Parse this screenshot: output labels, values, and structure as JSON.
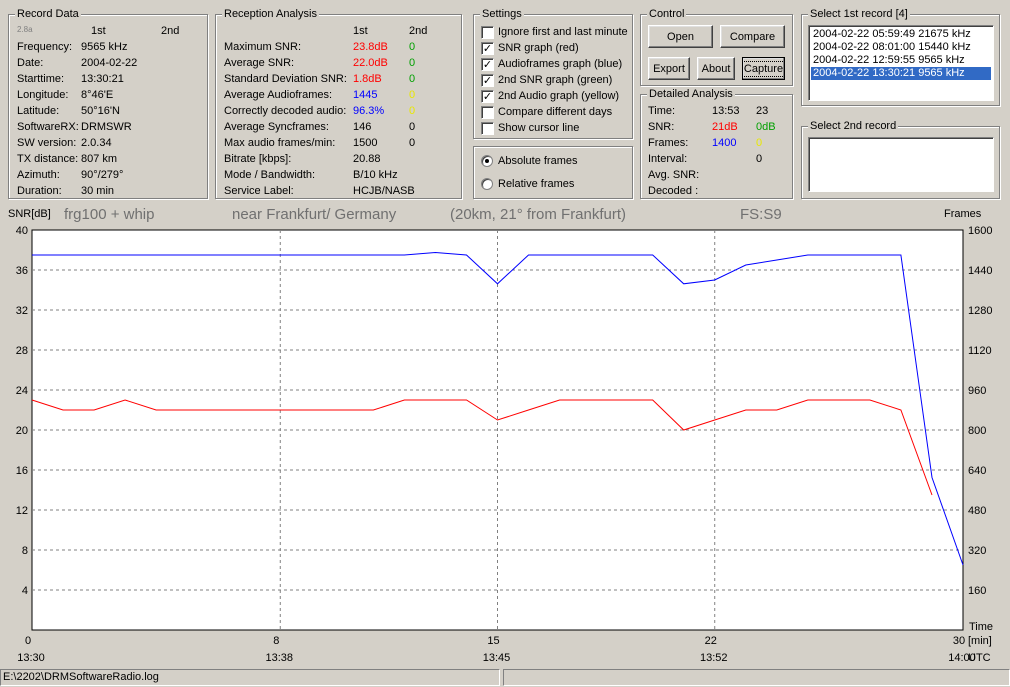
{
  "record_data": {
    "title": "Record Data",
    "ver": "2.8a",
    "col1": "1st",
    "col2": "2nd",
    "rows": [
      {
        "label": "Frequency:",
        "value": "9565 kHz"
      },
      {
        "label": "Date:",
        "value": "2004-02-22"
      },
      {
        "label": "Starttime:",
        "value": "13:30:21"
      },
      {
        "label": "Longitude:",
        "value": "8°46'E"
      },
      {
        "label": "Latitude:",
        "value": "50°16'N"
      },
      {
        "label": "SoftwareRX:",
        "value": "DRMSWR"
      },
      {
        "label": "SW version:",
        "value": "2.0.34"
      },
      {
        "label": "TX distance:",
        "value": "807 km"
      },
      {
        "label": "Azimuth:",
        "value": "90°/279°"
      },
      {
        "label": "Duration:",
        "value": "30 min"
      }
    ]
  },
  "reception": {
    "title": "Reception Analysis",
    "col1": "1st",
    "col2": "2nd",
    "rows": [
      {
        "label": "Maximum SNR:",
        "v1": "23.8dB",
        "v2": "0",
        "c1": "red",
        "c2": "green"
      },
      {
        "label": "Average SNR:",
        "v1": "22.0dB",
        "v2": "0",
        "c1": "red",
        "c2": "green"
      },
      {
        "label": "Standard Deviation SNR:",
        "v1": "1.8dB",
        "v2": "0",
        "c1": "red",
        "c2": "green"
      },
      {
        "label": "Average Audioframes:",
        "v1": "1445",
        "v2": "0",
        "c1": "blue",
        "c2": "yellow"
      },
      {
        "label": "Correctly decoded audio:",
        "v1": "96.3%",
        "v2": "0",
        "c1": "blue",
        "c2": "yellow"
      },
      {
        "label": "Average Syncframes:",
        "v1": "146",
        "v2": "0",
        "c1": "",
        "c2": ""
      },
      {
        "label": "Max audio frames/min:",
        "v1": "1500",
        "v2": "0",
        "c1": "",
        "c2": ""
      },
      {
        "label": "Bitrate [kbps]:",
        "v1": "20.88",
        "v2": "",
        "c1": "",
        "c2": ""
      },
      {
        "label": "Mode / Bandwidth:",
        "v1": "B/10 kHz",
        "v2": "",
        "c1": "",
        "c2": ""
      },
      {
        "label": "Service Label:",
        "v1": "HCJB/NASB",
        "v2": "",
        "c1": "",
        "c2": ""
      }
    ]
  },
  "settings": {
    "title": "Settings",
    "checkboxes": [
      {
        "label": "Ignore first and last minute",
        "checked": false
      },
      {
        "label": "SNR graph (red)",
        "checked": true
      },
      {
        "label": "Audioframes graph (blue)",
        "checked": true
      },
      {
        "label": "2nd SNR graph (green)",
        "checked": true
      },
      {
        "label": "2nd Audio graph (yellow)",
        "checked": true
      },
      {
        "label": "Compare different days",
        "checked": false
      },
      {
        "label": "Show cursor line",
        "checked": false
      }
    ],
    "radios": [
      {
        "label": "Absolute frames",
        "checked": true
      },
      {
        "label": "Relative frames",
        "checked": false
      }
    ]
  },
  "control": {
    "title": "Control",
    "open": "Open",
    "compare": "Compare",
    "export": "Export",
    "about": "About",
    "capture": "Capture"
  },
  "detailed": {
    "title": "Detailed Analysis",
    "rows": [
      {
        "label": "Time:",
        "v1": "13:53",
        "v2": "23",
        "c1": "",
        "c2": ""
      },
      {
        "label": "SNR:",
        "v1": "21dB",
        "v2": "0dB",
        "c1": "red",
        "c2": "green"
      },
      {
        "label": "Frames:",
        "v1": "1400",
        "v2": "0",
        "c1": "blue",
        "c2": "yellow"
      },
      {
        "label": "Interval:",
        "v1": "",
        "v2": "0",
        "c1": "",
        "c2": ""
      },
      {
        "label": "Avg. SNR:",
        "v1": "",
        "v2": "",
        "c1": "",
        "c2": ""
      },
      {
        "label": "Decoded :",
        "v1": "",
        "v2": "",
        "c1": "",
        "c2": ""
      }
    ]
  },
  "select1": {
    "title": "Select 1st record [4]",
    "items": [
      "2004-02-22 05:59:49 21675 kHz",
      "2004-02-22 08:01:00 15440 kHz",
      "2004-02-22 12:59:55 9565 kHz",
      "2004-02-22 13:30:21 9565 kHz"
    ],
    "selected": 3
  },
  "select2": {
    "title": "Select 2nd record",
    "items": []
  },
  "chart_header": {
    "t1": "frg100 + whip",
    "t2": "near Frankfurt/ Germany",
    "t3": "(20km, 21° from Frankfurt)",
    "t4": "FS:S9"
  },
  "chart_data": {
    "type": "line",
    "ylabel": "SNR[dB]",
    "y2label": "Frames",
    "xunit": "[min]",
    "tz": "UTC",
    "time_label": "Time",
    "ylim": [
      0,
      40
    ],
    "y2lim": [
      0,
      1600
    ],
    "xlim": [
      0,
      30
    ],
    "yticks": [
      4,
      8,
      12,
      16,
      20,
      24,
      28,
      32,
      36,
      40
    ],
    "y2ticks": [
      160,
      320,
      480,
      640,
      800,
      960,
      1120,
      1280,
      1440,
      1600
    ],
    "xticks": [
      {
        "min": 0,
        "time": "13:30"
      },
      {
        "min": 8,
        "time": "13:38"
      },
      {
        "min": 15,
        "time": "13:45"
      },
      {
        "min": 22,
        "time": "13:52"
      },
      {
        "min": 30,
        "time": "14:00"
      }
    ],
    "grid": true,
    "series": [
      {
        "name": "SNR graph (red)",
        "axis": "left",
        "color": "#ff0000",
        "x": [
          0,
          1,
          2,
          3,
          4,
          5,
          6,
          7,
          8,
          9,
          10,
          11,
          12,
          13,
          14,
          15,
          16,
          17,
          18,
          19,
          20,
          21,
          22,
          23,
          24,
          25,
          26,
          27,
          28,
          29,
          30
        ],
        "y": [
          23,
          22,
          22,
          23,
          22,
          22,
          22,
          22,
          22,
          22,
          22,
          22,
          23,
          23,
          23,
          21,
          22,
          23,
          23,
          23,
          23,
          20,
          21,
          22,
          22,
          23,
          23,
          23,
          22,
          13.5,
          null
        ]
      },
      {
        "name": "Audioframes graph (blue)",
        "axis": "right",
        "color": "#0000ff",
        "x": [
          0,
          1,
          2,
          3,
          4,
          5,
          6,
          7,
          8,
          9,
          10,
          11,
          12,
          13,
          14,
          15,
          16,
          17,
          18,
          19,
          20,
          21,
          22,
          23,
          24,
          25,
          26,
          27,
          28,
          29,
          30
        ],
        "y": [
          1500,
          1500,
          1500,
          1500,
          1500,
          1500,
          1500,
          1500,
          1500,
          1500,
          1500,
          1500,
          1500,
          1510,
          1500,
          1385,
          1500,
          1500,
          1500,
          1500,
          1500,
          1385,
          1400,
          1460,
          1480,
          1500,
          1500,
          1500,
          1500,
          610,
          260
        ]
      }
    ]
  },
  "status": {
    "path": "E:\\2202\\DRMSoftwareRadio.log"
  }
}
